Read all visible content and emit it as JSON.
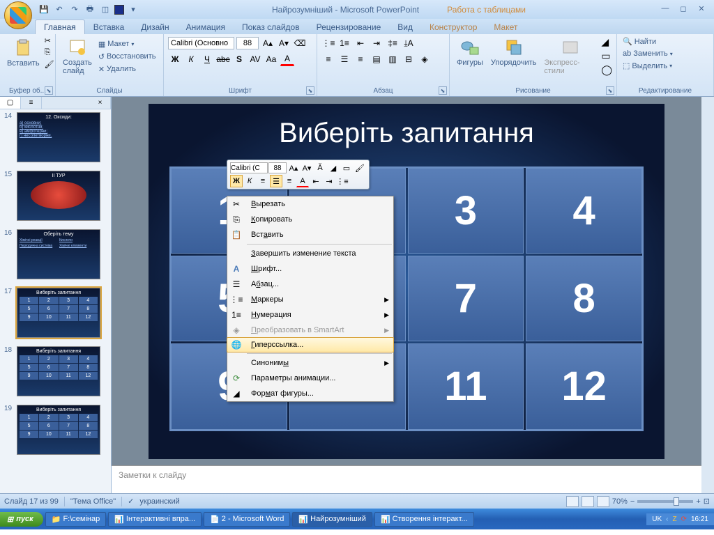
{
  "title": {
    "doc": "Найрозумніший",
    "app": "Microsoft PowerPoint",
    "context_tools": "Работа с таблицами"
  },
  "qat": {
    "save": "💾",
    "undo": "↶",
    "redo": "↷",
    "print": "🖶",
    "new": "◫"
  },
  "tabs": [
    "Главная",
    "Вставка",
    "Дизайн",
    "Анимация",
    "Показ слайдов",
    "Рецензирование",
    "Вид",
    "Конструктор",
    "Макет"
  ],
  "ribbon": {
    "clipboard": {
      "paste": "Вставить",
      "label": "Буфер об..."
    },
    "slides": {
      "new_slide": "Создать\nслайд",
      "layout": "Макет",
      "reset": "Восстановить",
      "delete": "Удалить",
      "label": "Слайды"
    },
    "font": {
      "family": "Calibri (Основно",
      "size": "88",
      "label": "Шрифт"
    },
    "paragraph": {
      "label": "Абзац"
    },
    "drawing": {
      "shapes": "Фигуры",
      "arrange": "Упорядочить",
      "styles": "Экспресс-стили",
      "label": "Рисование"
    },
    "editing": {
      "find": "Найти",
      "replace": "Заменить",
      "select": "Выделить",
      "label": "Редактирование"
    }
  },
  "thumbs": {
    "items": [
      {
        "n": "14",
        "title": "12. Оксиди:",
        "lines": [
          "а) основни;",
          "б) кислотни;",
          "в) амфотерни;",
          "г) несолетворни."
        ]
      },
      {
        "n": "15",
        "title": "ІІ ТУР",
        "img": true
      },
      {
        "n": "16",
        "title": "Оберіть тему",
        "links": true
      },
      {
        "n": "17",
        "title": "Виберіть запитання",
        "grid": true
      },
      {
        "n": "18",
        "title": "Виберіть запитання",
        "grid": true
      },
      {
        "n": "19",
        "title": "Виберіть запитання",
        "grid": true
      }
    ]
  },
  "slide": {
    "title": "Виберіть запитання",
    "cells": [
      "1",
      "2",
      "3",
      "4",
      "5",
      "6",
      "7",
      "8",
      "9",
      "10",
      "11",
      "12"
    ]
  },
  "mini": {
    "font": "Calibri (С",
    "size": "88"
  },
  "context_menu": {
    "cut": "Вырезать",
    "copy": "Копировать",
    "paste": "Вставить",
    "end_edit": "Завершить изменение текста",
    "font": "Шрифт...",
    "para": "Абзац...",
    "bullets": "Маркеры",
    "numbering": "Нумерация",
    "smartart": "Преобразовать в SmartArt",
    "hyperlink": "Гиперссылка...",
    "synonyms": "Синонимы",
    "anim": "Параметры анимации...",
    "shape_fmt": "Формат фигуры..."
  },
  "notes": "Заметки к слайду",
  "status": {
    "slide": "Слайд 17 из 99",
    "theme": "\"Тема Office\"",
    "lang": "украинский",
    "zoom": "70%"
  },
  "taskbar": {
    "start": "пуск",
    "items": [
      "F:\\семінар",
      "Інтерактивні впра...",
      "2 - Microsoft Word",
      "Найрозумніший",
      "Створення інтеракт..."
    ],
    "lang": "UK",
    "time": "16:21"
  }
}
